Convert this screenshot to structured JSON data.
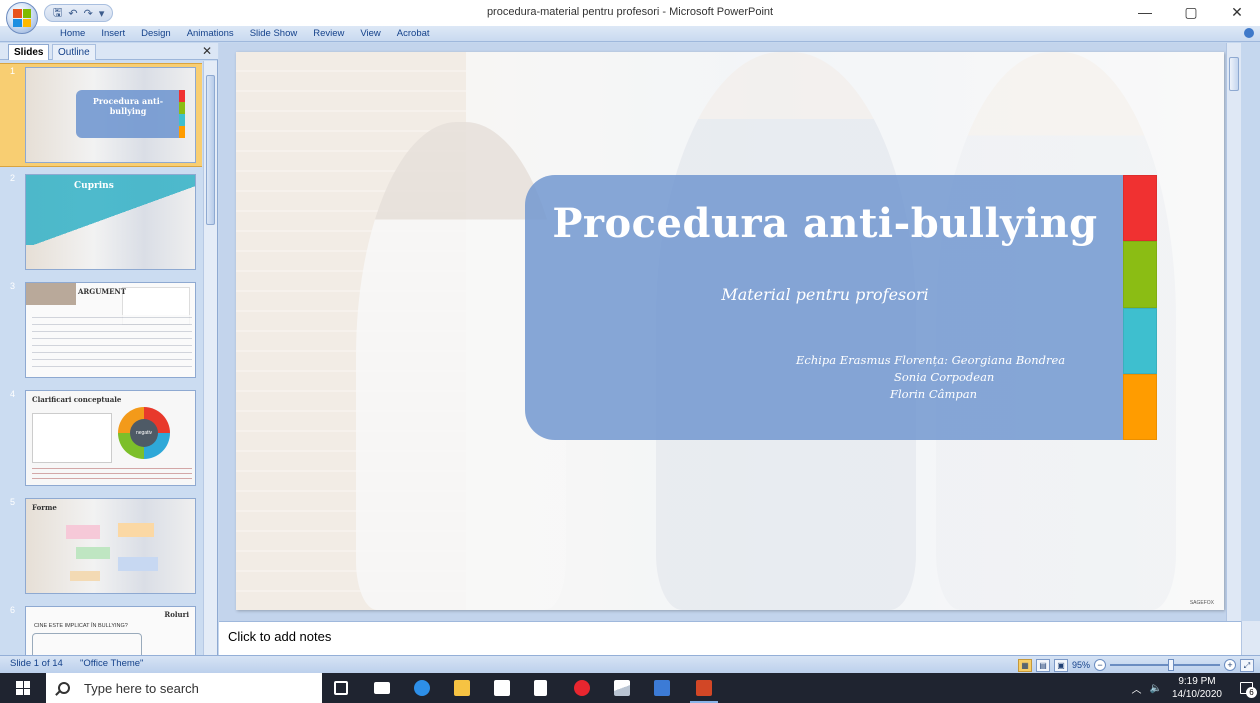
{
  "window": {
    "title": "procedura-material pentru profesori - Microsoft PowerPoint",
    "controls": {
      "minimize": "—",
      "maximize": "▢",
      "close": "✕"
    }
  },
  "quick_access": {
    "save": "🖫",
    "undo": "↶",
    "redo": "↷",
    "customize": "▾"
  },
  "ribbon": {
    "tabs": [
      "Home",
      "Insert",
      "Design",
      "Animations",
      "Slide Show",
      "Review",
      "View",
      "Acrobat"
    ]
  },
  "left_panel": {
    "tabs": {
      "slides": "Slides",
      "outline": "Outline"
    },
    "close": "✕",
    "thumbnails": [
      {
        "number": "1",
        "title": "Procedura anti-bullying"
      },
      {
        "number": "2",
        "title": "Cuprins"
      },
      {
        "number": "3",
        "title": "ARGUMENT"
      },
      {
        "number": "4",
        "title": "Clarificari conceptuale",
        "badge": "negativ"
      },
      {
        "number": "5",
        "title": "Forme"
      },
      {
        "number": "6",
        "title": "Roluri",
        "subtitle": "CINE ESTE IMPLICAT ÎN BULLYING?"
      }
    ]
  },
  "slide": {
    "title": "Procedura anti-bullying",
    "subtitle": "Material pentru profesori",
    "authors": [
      "Echipa Erasmus Florența: Georgiana Bondrea",
      "Sonia Corpodean",
      "Florin Câmpan"
    ],
    "footer_mark": "SAGEFOX",
    "colors": {
      "box": "#7298d0",
      "bar": [
        "#f03131",
        "#8bbd14",
        "#3ebfcf",
        "#ff9c00"
      ]
    }
  },
  "notes": {
    "placeholder": "Click to add notes"
  },
  "status": {
    "slide_of": "Slide 1 of 14",
    "theme": "\"Office Theme\"",
    "zoom": "95%"
  },
  "taskbar": {
    "search_placeholder": "Type here to search",
    "apps": [
      "task-view-icon",
      "mail-icon",
      "edge-icon",
      "file-explorer-icon",
      "store-icon",
      "document-icon",
      "opera-icon",
      "scanner-icon",
      "publisher-icon",
      "powerpoint-icon"
    ],
    "time": "9:19 PM",
    "date": "14/10/2020",
    "notifications": "6"
  }
}
